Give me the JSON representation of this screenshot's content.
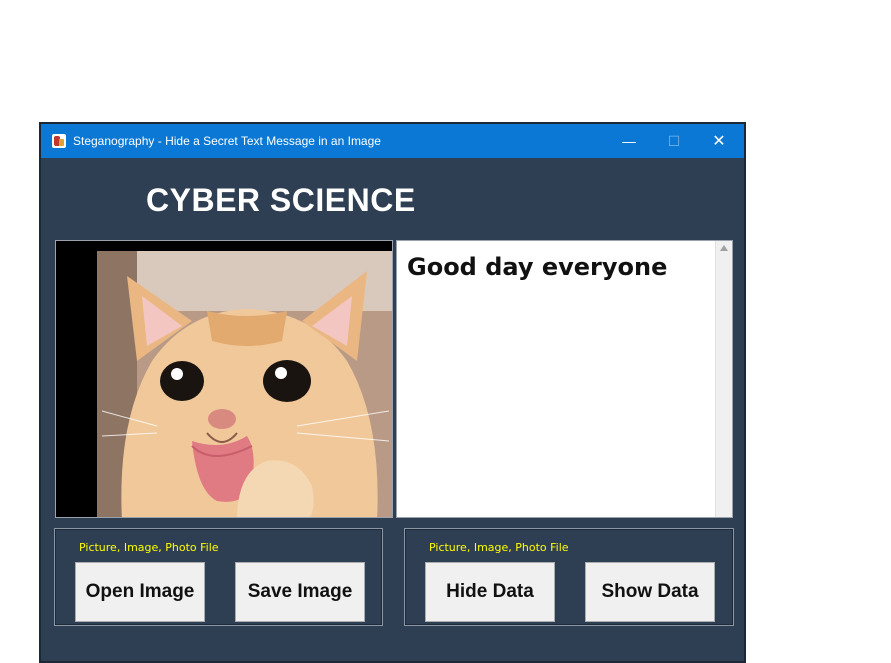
{
  "window": {
    "title": "Steganography - Hide a Secret Text Message in an Image",
    "minimize_glyph": "—",
    "maximize_glyph": "☐",
    "close_glyph": "✕"
  },
  "heading": "CYBER SCIENCE",
  "image_panel": {
    "image": "cat-photo"
  },
  "text_panel": {
    "content": "Good day everyone"
  },
  "left_group": {
    "label": "Picture, Image, Photo File",
    "open_label": "Open Image",
    "save_label": "Save Image"
  },
  "right_group": {
    "label": "Picture, Image, Photo File",
    "hide_label": "Hide Data",
    "show_label": "Show Data"
  },
  "colors": {
    "window_bg": "#2e3e53",
    "titlebar": "#0a78d4",
    "group_label": "#ffff00"
  }
}
